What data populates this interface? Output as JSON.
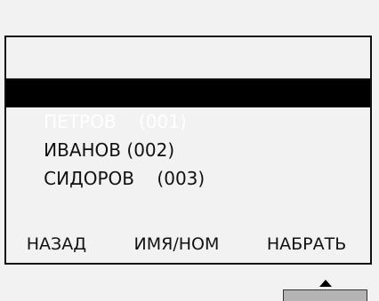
{
  "contacts": [
    {
      "name": "ПЕТРОВ",
      "spacer": "    ",
      "number": "(001)",
      "selected": true
    },
    {
      "name": "ИВАНОВ",
      "spacer": " ",
      "number": "(002)",
      "selected": false
    },
    {
      "name": "СИДОРОВ",
      "spacer": "    ",
      "number": "(003)",
      "selected": false
    }
  ],
  "softkeys": {
    "left": "НАЗАД",
    "middle": "ИМЯ/НОМ",
    "right": "НАБРАТЬ"
  },
  "icons": {
    "scroll_indicator": "up-arrow-icon"
  },
  "colors": {
    "background": "#f2f2f2",
    "selection": "#000000",
    "text": "#111111",
    "scroll_bar": "#b4b4b4"
  }
}
